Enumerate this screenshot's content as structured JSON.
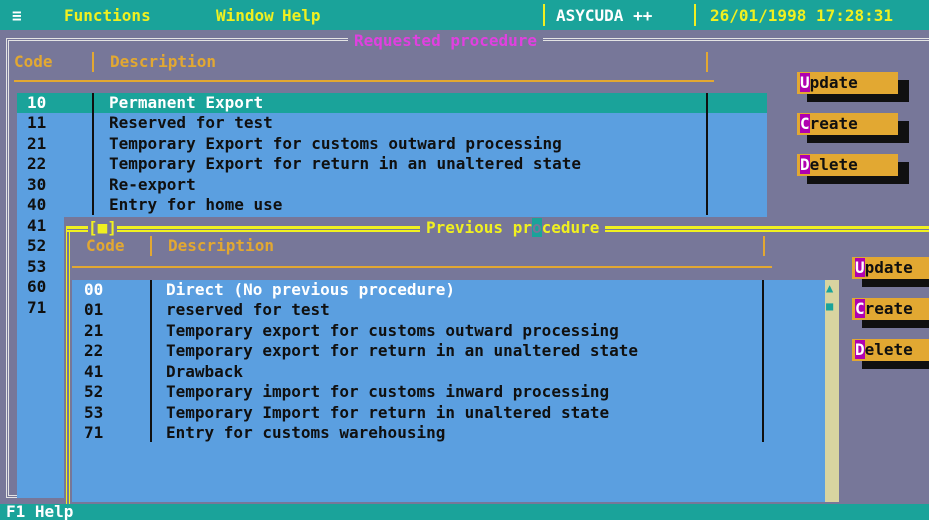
{
  "menubar": {
    "menu_icon": "≡",
    "functions": "Functions",
    "window": "Window",
    "help": "Help",
    "app": "ASYCUDA ++",
    "datetime": "26/01/1998 17:28:31"
  },
  "requested": {
    "title": "Requested procedure",
    "col_code": "Code",
    "col_desc": "Description",
    "rows": [
      {
        "code": "10",
        "desc": "Permanent Export"
      },
      {
        "code": "11",
        "desc": "Reserved for test"
      },
      {
        "code": "21",
        "desc": "Temporary Export for customs outward processing"
      },
      {
        "code": "22",
        "desc": "Temporary Export for return in an unaltered state"
      },
      {
        "code": "30",
        "desc": "Re-export"
      },
      {
        "code": "40",
        "desc": "Entry for home use"
      },
      {
        "code": "41",
        "desc": ""
      },
      {
        "code": "52",
        "desc": ""
      },
      {
        "code": "53",
        "desc": ""
      },
      {
        "code": "60",
        "desc": ""
      },
      {
        "code": "71",
        "desc": ""
      }
    ],
    "buttons": {
      "update_hot": "U",
      "update_rest": "pdate",
      "create_hot": "C",
      "create_rest": "reate",
      "delete_hot": "D",
      "delete_rest": "elete"
    }
  },
  "previous": {
    "title_before": "Previous pr",
    "title_cursor": "o",
    "title_after": "cedure",
    "close_glyph": "[■]",
    "col_code": "Code",
    "col_desc": "Description",
    "rows": [
      {
        "code": "00",
        "desc": "Direct (No previous procedure)"
      },
      {
        "code": "01",
        "desc": "reserved for test"
      },
      {
        "code": "21",
        "desc": "Temporary export for customs outward processing"
      },
      {
        "code": "22",
        "desc": "Temporary export for return in an unaltered state"
      },
      {
        "code": "41",
        "desc": "Drawback"
      },
      {
        "code": "52",
        "desc": "Temporary import for customs inward processing"
      },
      {
        "code": "53",
        "desc": "Temporary Import for return in unaltered state"
      },
      {
        "code": "71",
        "desc": "Entry for customs warehousing"
      }
    ],
    "buttons": {
      "update_hot": "U",
      "update_rest": "pdate",
      "create_hot": "C",
      "create_rest": "reate",
      "delete_hot": "D",
      "delete_rest": "elete"
    },
    "scroll_up": "▲",
    "scroll_thumb": "■"
  },
  "statusbar": {
    "f1": "F1 Help"
  },
  "colors": {
    "background": "#777799",
    "menubar": "#1aa39a",
    "list": "#5b9fe0",
    "accent_yellow": "#f0f020",
    "header": "#e2a832",
    "requested_title": "#e040e0"
  }
}
